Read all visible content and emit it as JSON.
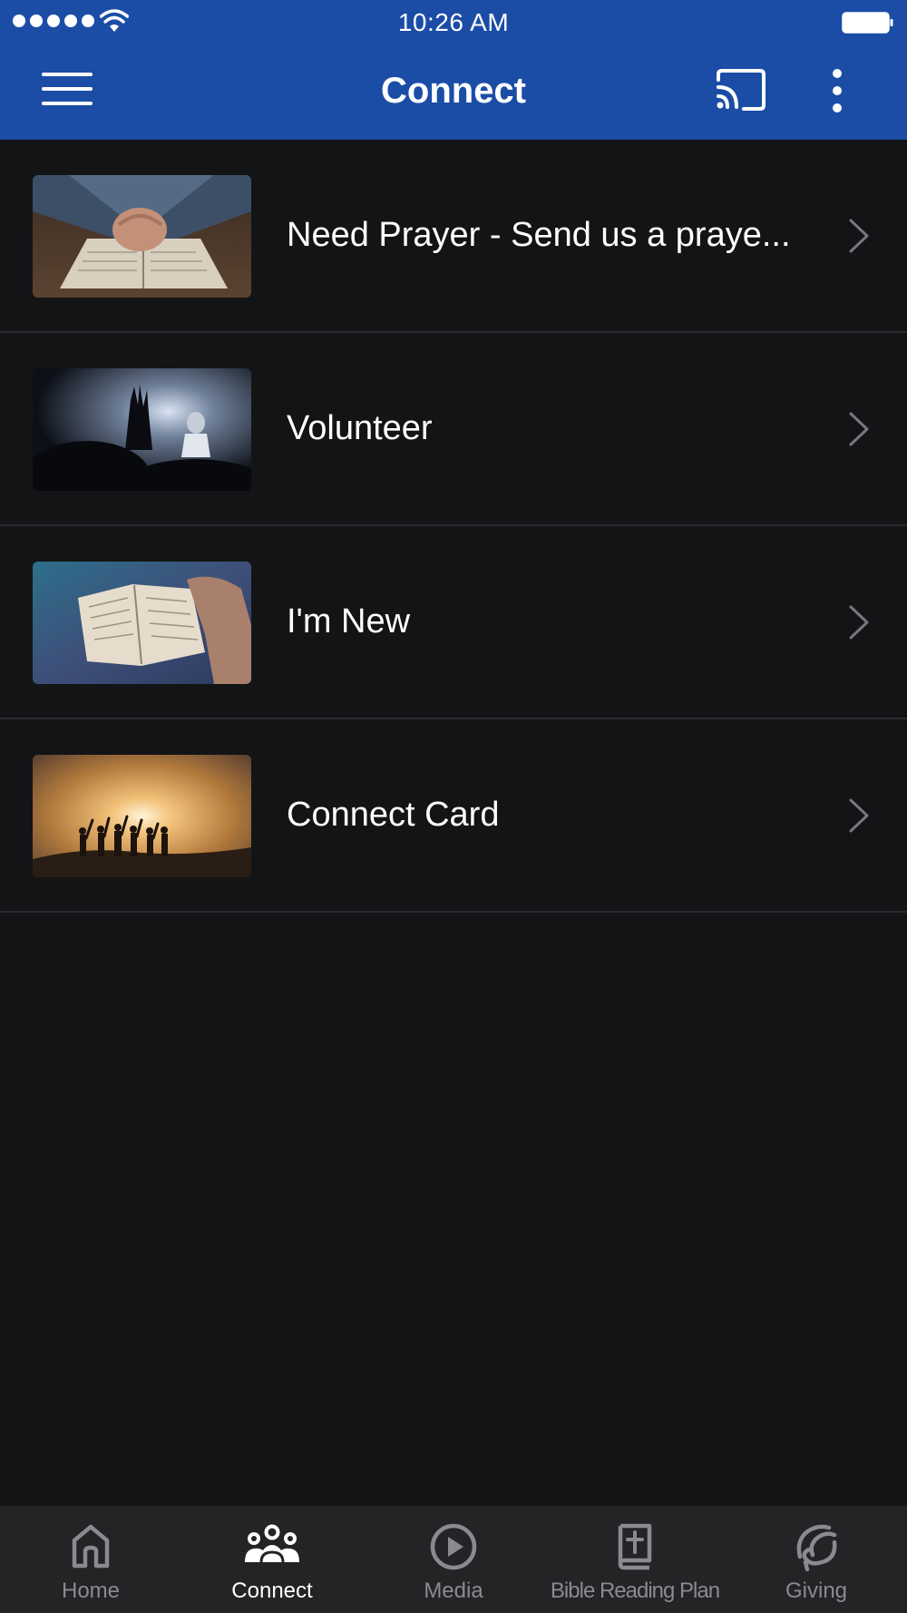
{
  "status_bar": {
    "time": "10:26 AM"
  },
  "app_bar": {
    "title": "Connect"
  },
  "list": {
    "items": [
      {
        "label": "Need Prayer - Send us a praye...",
        "image": "hands-on-bible-photo"
      },
      {
        "label": "Volunteer",
        "image": "worship-hands-raised-photo"
      },
      {
        "label": "I'm New",
        "image": "open-bible-photo"
      },
      {
        "label": "Connect Card",
        "image": "people-silhouette-sunset-photo"
      }
    ]
  },
  "bottom_nav": {
    "active": "Connect",
    "items": [
      {
        "label": "Home",
        "icon": "home-icon"
      },
      {
        "label": "Connect",
        "icon": "people-icon"
      },
      {
        "label": "Media",
        "icon": "play-circle-icon"
      },
      {
        "label": "Bible Reading Plan",
        "icon": "bible-icon"
      },
      {
        "label": "Giving",
        "icon": "giving-icon"
      }
    ]
  },
  "colors": {
    "header": "#1b4da6",
    "background": "#131416",
    "nav_background": "#232426",
    "nav_inactive": "#8a8b8e",
    "divider": "#2a2b2e"
  }
}
